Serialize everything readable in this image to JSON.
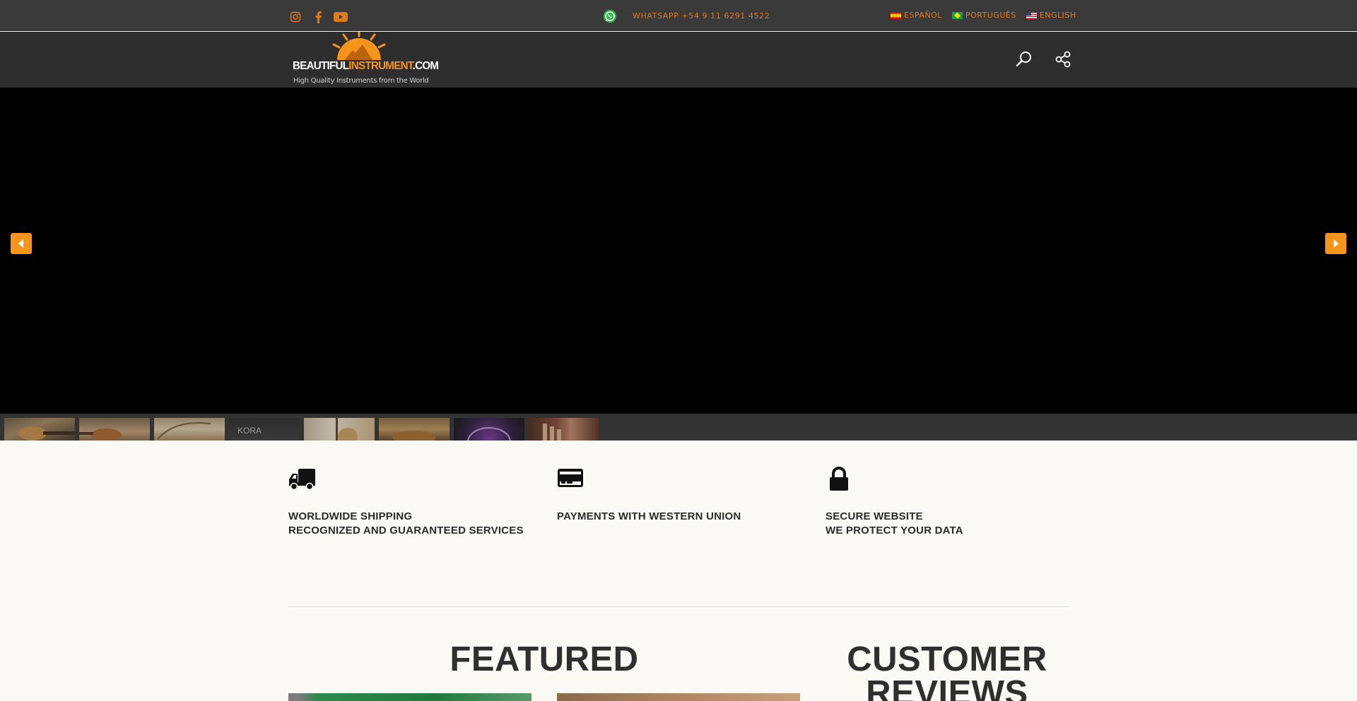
{
  "topbar": {
    "social": [
      {
        "name": "instagram-icon"
      },
      {
        "name": "facebook-icon"
      },
      {
        "name": "youtube-icon"
      }
    ],
    "whatsapp": "WHATSAPP +54 9 11 6291 4522",
    "languages": [
      {
        "label": "ESPAÑOL",
        "flag": "es"
      },
      {
        "label": "PORTUGUÊS",
        "flag": "br"
      },
      {
        "label": "ENGLISH",
        "flag": "us"
      }
    ]
  },
  "header": {
    "logo_part1": "BEAUTIFUL",
    "logo_part2": "INSTRUMENT",
    "logo_part3": ".COM",
    "logo_tagline": "High Quality Instruments from the World"
  },
  "slider": {
    "thumb_labels": [
      "",
      "",
      "",
      "KORA",
      "",
      "",
      "",
      ""
    ]
  },
  "features": [
    {
      "icon": "truck-icon",
      "lines": [
        "WORLDWIDE SHIPPING",
        "RECOGNIZED AND GUARANTEED SERVICES"
      ]
    },
    {
      "icon": "credit-card-icon",
      "lines": [
        "PAYMENTS WITH WESTERN UNION",
        ""
      ]
    },
    {
      "icon": "lock-icon",
      "lines": [
        "SECURE WEBSITE",
        "WE PROTECT YOUR DATA"
      ]
    }
  ],
  "sections": {
    "featured_title": "FEATURED",
    "reviews_title_1": "CUSTOMER",
    "reviews_title_2": "REVIEWS"
  },
  "colors": {
    "accent": "#f7941d",
    "topbar_text": "#e07a1f",
    "page_bg": "#faf9f4"
  }
}
